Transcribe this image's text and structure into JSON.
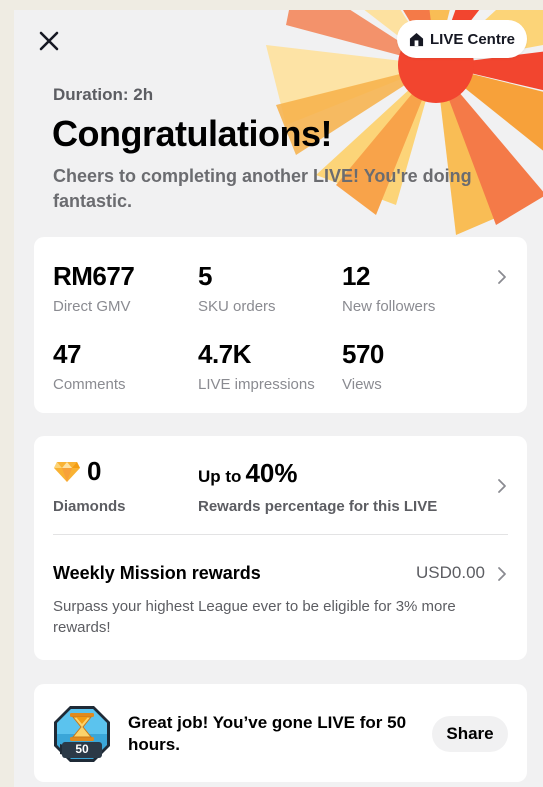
{
  "header": {
    "close_icon": "close-icon",
    "live_centre_label": "LIVE Centre",
    "live_centre_icon": "home-icon"
  },
  "summary": {
    "duration": "Duration: 2h",
    "title": "Congratulations!",
    "subtitle": "Cheers to completing another LIVE! You're doing fantastic."
  },
  "stats": [
    {
      "value": "RM677",
      "label": "Direct GMV"
    },
    {
      "value": "5",
      "label": "SKU orders"
    },
    {
      "value": "12",
      "label": "New followers"
    },
    {
      "value": "47",
      "label": "Comments"
    },
    {
      "value": "4.7K",
      "label": "LIVE impressions"
    },
    {
      "value": "570",
      "label": "Views"
    }
  ],
  "rewards": {
    "diamonds_value": "0",
    "diamonds_label": "Diamonds",
    "upto_prefix": "Up to",
    "upto_value": "40%",
    "rewards_label": "Rewards percentage for this LIVE",
    "weekly_title": "Weekly Mission rewards",
    "weekly_value": "USD0.00",
    "weekly_desc": "Surpass your highest League ever to be eligible for 3% more rewards!"
  },
  "achievement": {
    "badge_number": "50",
    "text": "Great job! You’ve gone LIVE for 50 hours.",
    "share_label": "Share"
  },
  "colors": {
    "accent_red": "#f2452f",
    "accent_orange": "#f7a13a",
    "accent_yellow": "#fcd478",
    "background": "#f1f1f2"
  }
}
